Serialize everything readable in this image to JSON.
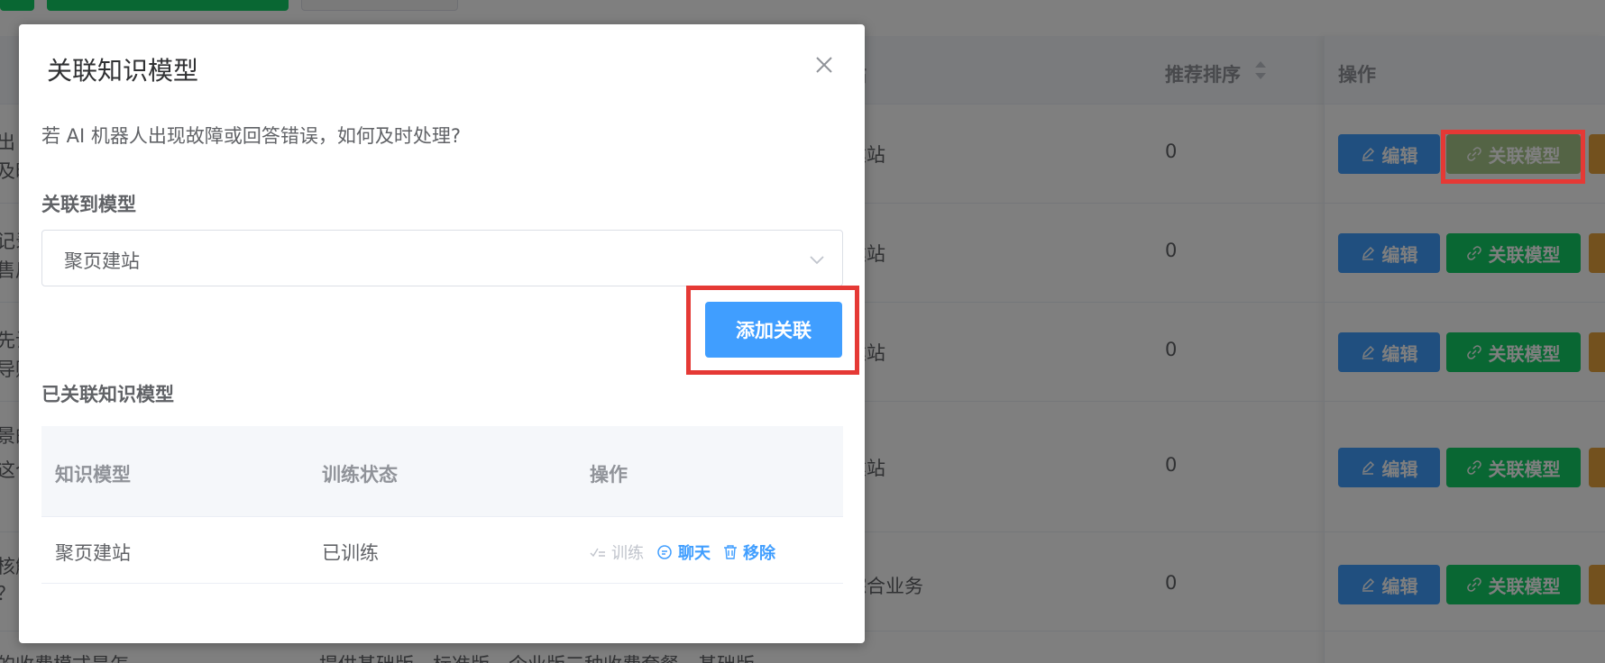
{
  "background": {
    "table_headers": {
      "category_partial": "站",
      "sort": "推荐排序",
      "actions": "操作"
    },
    "rows": [
      {
        "frag1": "出",
        "frag2": "及时",
        "category": "建站",
        "sort": "0"
      },
      {
        "frag1": "记录",
        "frag2": "售后",
        "category": "建站",
        "sort": "0"
      },
      {
        "frag1": "先设",
        "frag2": "导购",
        "category": "建站",
        "sort": "0"
      },
      {
        "frag1": "景的",
        "frag2": "这个",
        "category": "建站",
        "sort": "0"
      },
      {
        "frag1": "核解",
        "frag2": "？",
        "category": "综合业务",
        "sort": "0"
      }
    ],
    "bottom_row": {
      "frag1": "的收费模式是怎",
      "frag2": "提供基础版、标准版、企业版三种收费套餐，基础版"
    },
    "edit_label": "编辑",
    "link_label": "关联模型"
  },
  "dialog": {
    "title": "关联知识模型",
    "question": "若 AI 机器人出现故障或回答错误，如何及时处理?",
    "link_to_label": "关联到模型",
    "select_value": "聚页建站",
    "add_button": "添加关联",
    "linked_label": "已关联知识模型",
    "table": {
      "headers": [
        "知识模型",
        "训练状态",
        "操作"
      ],
      "rows": [
        {
          "model": "聚页建站",
          "status": "已训练"
        }
      ],
      "actions": {
        "train": "训练",
        "chat": "聊天",
        "remove": "移除"
      }
    }
  },
  "colors": {
    "primary": "#409eff",
    "success": "#13ce66",
    "warning": "#e6a23c",
    "highlight": "#e53935"
  }
}
